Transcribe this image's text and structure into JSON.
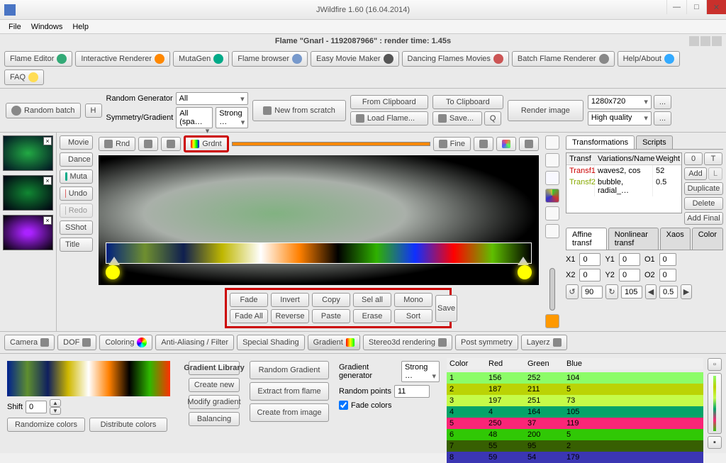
{
  "window": {
    "title": "JWildfire 1.60 (16.04.2014)",
    "min": "—",
    "max": "□",
    "close": "✕"
  },
  "menubar": {
    "file": "File",
    "windows": "Windows",
    "help": "Help"
  },
  "subtitle": "Flame \"Gnarl - 1192087966\" : render time: 1.45s",
  "tabs": {
    "flame_editor": "Flame Editor",
    "interactive": "Interactive Renderer",
    "mutagen": "MutaGen",
    "flame_browser": "Flame browser",
    "easy_movie": "Easy Movie Maker",
    "dancing": "Dancing Flames Movies",
    "batch": "Batch Flame Renderer",
    "help": "Help/About",
    "faq": "FAQ"
  },
  "toolbar": {
    "random_batch": "Random batch",
    "h": "H",
    "random_gen_label": "Random Generator",
    "random_gen_value": "All",
    "symgrad_label": "Symmetry/Gradient",
    "sym_value": "All (spa…",
    "grad_value": "Strong …",
    "new_scratch": "New from scratch",
    "from_clip": "From Clipboard",
    "to_clip": "To Clipboard",
    "load": "Load Flame...",
    "save": "Save...",
    "q": "Q",
    "render_image": "Render image",
    "res": "1280x720",
    "quality": "High quality",
    "dots": "..."
  },
  "sidebtns": {
    "movie": "Movie",
    "dance": "Dance",
    "muta": "Muta",
    "undo": "Undo",
    "redo": "Redo",
    "sshot": "SShot",
    "title": "Title"
  },
  "canvasbar": {
    "rnd": "Rnd",
    "grdnt": "Grdnt",
    "fine": "Fine"
  },
  "grad_ops": {
    "fade": "Fade",
    "invert": "Invert",
    "copy": "Copy",
    "selall": "Sel all",
    "mono": "Mono",
    "fadeall": "Fade All",
    "reverse": "Reverse",
    "paste": "Paste",
    "erase": "Erase",
    "sort": "Sort",
    "save": "Save"
  },
  "right": {
    "tab_transforms": "Transformations",
    "tab_scripts": "Scripts",
    "cols": {
      "transf": "Transf",
      "var": "Variations/Name",
      "weight": "Weight"
    },
    "rows": [
      {
        "t": "Transf1",
        "v": "waves2, cos",
        "w": "52"
      },
      {
        "t": "Transf2",
        "v": "bubble, radial_…",
        "w": "0.5"
      }
    ],
    "btns": {
      "zero": "0",
      "t": "T",
      "add": "Add",
      "l": "L",
      "dup": "Duplicate",
      "del": "Delete",
      "addfinal": "Add Final"
    },
    "subtabs": {
      "affine": "Affine transf",
      "nonlinear": "Nonlinear transf",
      "xaos": "Xaos",
      "color": "Color"
    },
    "params": {
      "x1l": "X1",
      "x1": "0",
      "y1l": "Y1",
      "y1": "0",
      "o1l": "O1",
      "o1": "0",
      "x2l": "X2",
      "x2": "0",
      "y2l": "Y2",
      "y2": "0",
      "o2l": "O2",
      "o2": "0",
      "deg": "90",
      "one": "105",
      "half": "0.5"
    }
  },
  "bottom_tabs": {
    "camera": "Camera",
    "dof": "DOF",
    "coloring": "Coloring",
    "aa": "Anti-Aliasing / Filter",
    "shading": "Special Shading",
    "gradient": "Gradient",
    "stereo": "Stereo3d rendering",
    "post": "Post symmetry",
    "layerz": "Layerz"
  },
  "bottom": {
    "shift_label": "Shift",
    "shift_val": "0",
    "randomize_colors": "Randomize colors",
    "distribute_colors": "Distribute colors",
    "glib": "Gradient Library",
    "cnew": "Create new",
    "modgrad": "Modify gradient",
    "balancing": "Balancing",
    "rand_grad": "Random Gradient",
    "extract": "Extract from flame",
    "cimg": "Create from image",
    "ggen_label": "Gradient generator",
    "ggen_val": "Strong …",
    "rpts_label": "Random points",
    "rpts_val": "11",
    "fadecolors": "Fade colors",
    "ct_hdr": {
      "c": "Color",
      "r": "Red",
      "g": "Green",
      "b": "Blue"
    },
    "ct_rows": [
      {
        "c": "1",
        "r": "156",
        "g": "252",
        "b": "104",
        "bg": "#8cfc68"
      },
      {
        "c": "2",
        "r": "187",
        "g": "211",
        "b": "5",
        "bg": "#bbd305"
      },
      {
        "c": "3",
        "r": "197",
        "g": "251",
        "b": "73",
        "bg": "#c5fb49"
      },
      {
        "c": "4",
        "r": "4",
        "g": "164",
        "b": "105",
        "bg": "#04a469"
      },
      {
        "c": "5",
        "r": "250",
        "g": "37",
        "b": "119",
        "bg": "#fa2577"
      },
      {
        "c": "6",
        "r": "48",
        "g": "200",
        "b": "5",
        "bg": "#30c805"
      },
      {
        "c": "7",
        "r": "55",
        "g": "95",
        "b": "2",
        "bg": "#375f02"
      },
      {
        "c": "8",
        "r": "59",
        "g": "54",
        "b": "179",
        "bg": "#3b36b3"
      }
    ]
  }
}
